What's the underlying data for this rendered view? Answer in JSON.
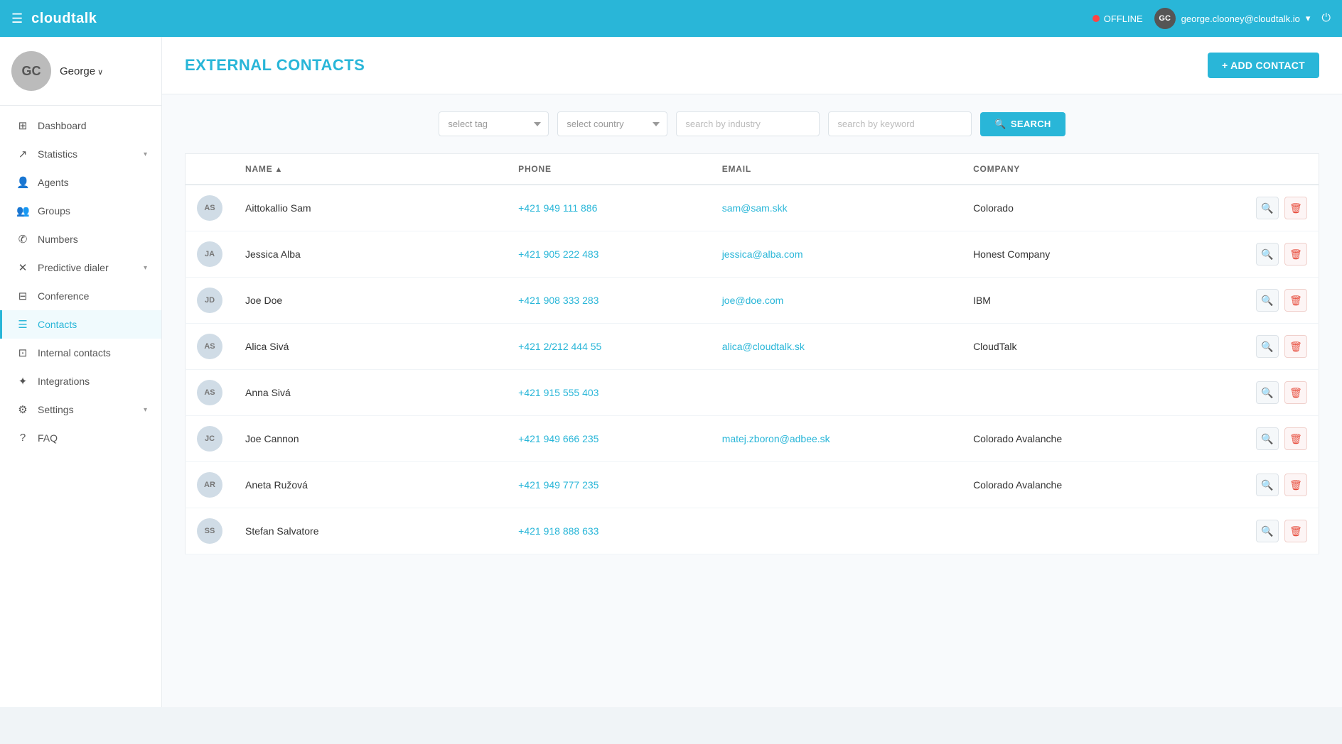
{
  "navbar": {
    "hamburger_icon": "☰",
    "logo": "cloudtalk",
    "status_label": "OFFLINE",
    "user_initials": "GC",
    "user_email": "george.clooney@cloudtalk.io",
    "power_icon": "⏻"
  },
  "sidebar": {
    "user_initials": "GC",
    "username": "George",
    "nav_items": [
      {
        "id": "dashboard",
        "label": "Dashboard",
        "icon": "⊞",
        "active": false
      },
      {
        "id": "statistics",
        "label": "Statistics",
        "icon": "↗",
        "active": false,
        "has_arrow": true
      },
      {
        "id": "agents",
        "label": "Agents",
        "icon": "👤",
        "active": false
      },
      {
        "id": "groups",
        "label": "Groups",
        "icon": "👥",
        "active": false
      },
      {
        "id": "numbers",
        "label": "Numbers",
        "icon": "✆",
        "active": false
      },
      {
        "id": "predictive-dialer",
        "label": "Predictive dialer",
        "icon": "✕",
        "active": false,
        "has_arrow": true
      },
      {
        "id": "conference",
        "label": "Conference",
        "icon": "⊟",
        "active": false
      },
      {
        "id": "contacts",
        "label": "Contacts",
        "icon": "☰",
        "active": true
      },
      {
        "id": "internal-contacts",
        "label": "Internal contacts",
        "icon": "⊡",
        "active": false
      },
      {
        "id": "integrations",
        "label": "Integrations",
        "icon": "✦",
        "active": false
      },
      {
        "id": "settings",
        "label": "Settings",
        "icon": "⚙",
        "active": false,
        "has_arrow": true
      },
      {
        "id": "faq",
        "label": "FAQ",
        "icon": "?",
        "active": false
      }
    ]
  },
  "page": {
    "title": "EXTERNAL CONTACTS",
    "add_contact_label": "+ ADD CONTACT"
  },
  "filters": {
    "select_tag_placeholder": "select tag",
    "select_country_placeholder": "select country",
    "search_industry_placeholder": "search by industry",
    "search_keyword_placeholder": "search by keyword",
    "search_button_label": "SEARCH"
  },
  "table": {
    "columns": [
      {
        "id": "name",
        "label": "NAME",
        "sort": true
      },
      {
        "id": "phone",
        "label": "PHONE"
      },
      {
        "id": "email",
        "label": "EMAIL"
      },
      {
        "id": "company",
        "label": "COMPANY"
      }
    ],
    "rows": [
      {
        "initials": "AS",
        "name": "Aittokallio Sam",
        "phone": "+421 949 111 886",
        "email": "sam@sam.skk",
        "company": "Colorado"
      },
      {
        "initials": "JA",
        "name": "Jessica Alba",
        "phone": "+421 905 222 483",
        "email": "jessica@alba.com",
        "company": "Honest Company"
      },
      {
        "initials": "JD",
        "name": "Joe Doe",
        "phone": "+421 908 333 283",
        "email": "joe@doe.com",
        "company": "IBM"
      },
      {
        "initials": "AS",
        "name": "Alica Sivá",
        "phone": "+421 2/212 444 55",
        "email": "alica@cloudtalk.sk",
        "company": "CloudTalk"
      },
      {
        "initials": "AS",
        "name": "Anna Sivá",
        "phone": "+421 915 555 403",
        "email": "",
        "company": ""
      },
      {
        "initials": "JC",
        "name": "Joe Cannon",
        "phone": "+421 949 666 235",
        "email": "matej.zboron@adbee.sk",
        "company": "Colorado Avalanche"
      },
      {
        "initials": "AR",
        "name": "Aneta Ružová",
        "phone": "+421 949 777 235",
        "email": "",
        "company": "Colorado Avalanche"
      },
      {
        "initials": "SS",
        "name": "Stefan Salvatore",
        "phone": "+421 918 888 633",
        "email": "",
        "company": ""
      }
    ]
  }
}
